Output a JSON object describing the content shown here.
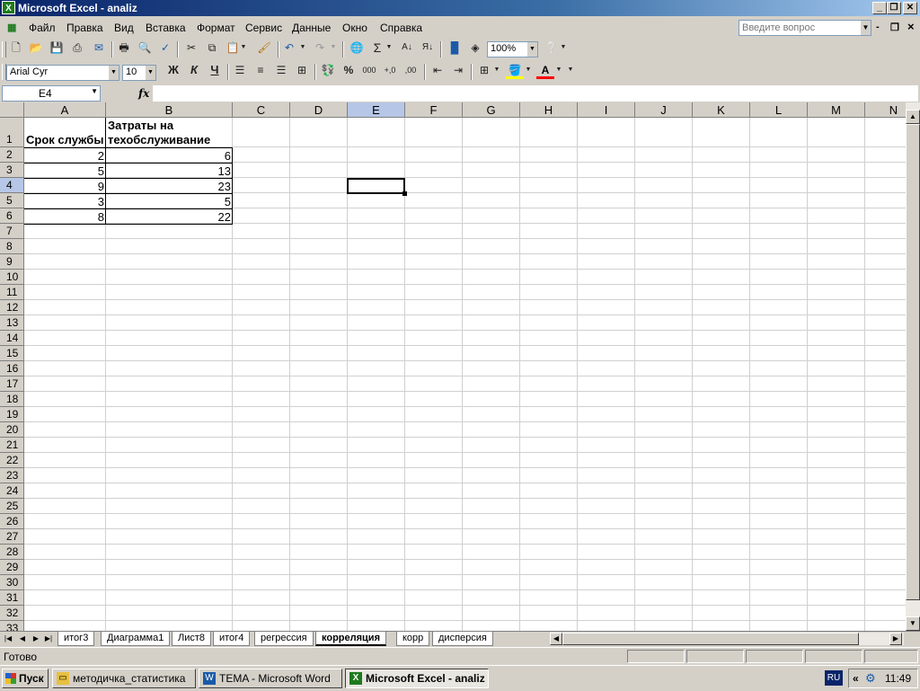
{
  "window": {
    "title": "Microsoft Excel - analiz",
    "app_icon": "X",
    "minimize": "_",
    "restore": "❐",
    "close": "✕"
  },
  "menu": {
    "items": [
      "Файл",
      "Правка",
      "Вид",
      "Вставка",
      "Формат",
      "Сервис",
      "Данные",
      "Окно",
      "Справка"
    ],
    "help_placeholder": "Введите вопрос",
    "doc_min": "-",
    "doc_restore": "❐",
    "doc_close": "×"
  },
  "toolbar": {
    "zoom": "100%",
    "font": "Arial Cyr",
    "size": "10",
    "bold": "Ж",
    "italic": "К",
    "underline": "Ч"
  },
  "formula_bar": {
    "name_box": "E4",
    "fx": "fx",
    "content": ""
  },
  "grid": {
    "columns": [
      "A",
      "B",
      "C",
      "D",
      "E",
      "F",
      "G",
      "H",
      "I",
      "J",
      "K",
      "L",
      "M",
      "N"
    ],
    "active_column": "E",
    "rows": [
      "1",
      "2",
      "3",
      "4",
      "5",
      "6",
      "7",
      "8",
      "9",
      "10",
      "11",
      "12",
      "13",
      "14",
      "15",
      "16",
      "17",
      "18",
      "19",
      "20",
      "21",
      "22",
      "23",
      "24",
      "25",
      "26",
      "27",
      "28",
      "29",
      "30",
      "31",
      "32",
      "33"
    ],
    "active_row": "4",
    "header_a": "Срок службы",
    "header_b_line1": "Затраты на",
    "header_b_line2": "техобслуживание",
    "data": [
      {
        "a": "2",
        "b": "6"
      },
      {
        "a": "5",
        "b": "13"
      },
      {
        "a": "9",
        "b": "23"
      },
      {
        "a": "3",
        "b": "5"
      },
      {
        "a": "8",
        "b": "22"
      }
    ]
  },
  "sheet_tabs": [
    "итог3",
    "Диаграмма1",
    "Лист8",
    "итог4",
    "регрессия",
    "корреляция",
    "корр",
    "дисперсия"
  ],
  "active_tab": "корреляция",
  "status": {
    "text": "Готово"
  },
  "taskbar": {
    "start": "Пуск",
    "tasks": [
      {
        "label": "методичка_статистика",
        "icon": "folder-icon"
      },
      {
        "label": "TEMA - Microsoft Word",
        "icon": "word-icon"
      },
      {
        "label": "Microsoft Excel - analiz",
        "icon": "excel-icon"
      }
    ],
    "lang": "RU",
    "tray_arrow": "«",
    "time": "11:49"
  }
}
